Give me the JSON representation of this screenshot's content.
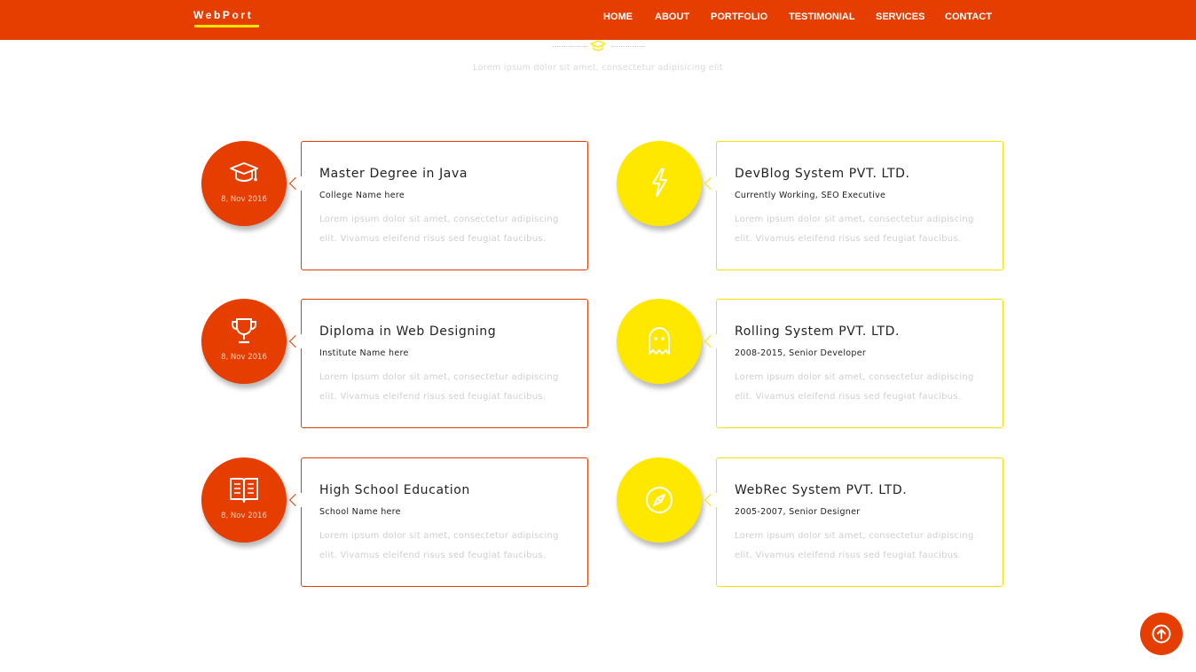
{
  "brand": {
    "name": "WebPort"
  },
  "nav": {
    "items": [
      {
        "label": "HOME"
      },
      {
        "label": "ABOUT"
      },
      {
        "label": "PORTFOLIO"
      },
      {
        "label": "TESTIMONIAL"
      },
      {
        "label": "SERVICES"
      },
      {
        "label": "CONTACT"
      }
    ]
  },
  "section": {
    "subtitle": "Lorem ipsum dolor sit amet, consectetur adipisicing elit",
    "icon": "graduation-cap-icon"
  },
  "education": [
    {
      "icon": "graduation-cap-icon",
      "date": "8, Nov 2016",
      "title": "Master Degree in Java",
      "subtitle": "College Name here",
      "description": "Lorem ipsum dolor sit amet, consectetur adipiscing elit. Vivamus eleifend risus sed feugiat faucibus."
    },
    {
      "icon": "trophy-icon",
      "date": "8, Nov 2016",
      "title": "Diploma in Web Designing",
      "subtitle": "Institute Name here",
      "description": "Lorem ipsum dolor sit amet, consectetur adipiscing elit. Vivamus eleifend risus sed feugiat faucibus."
    },
    {
      "icon": "book-icon",
      "date": "8, Nov 2016",
      "title": "High School Education",
      "subtitle": "School Name here",
      "description": "Lorem ipsum dolor sit amet, consectetur adipiscing elit. Vivamus eleifend risus sed feugiat faucibus."
    }
  ],
  "experience": [
    {
      "icon": "lightning-icon",
      "title": "DevBlog System PVT. LTD.",
      "subtitle": "Currently Working, SEO Executive",
      "description": "Lorem ipsum dolor sit amet, consectetur adipiscing elit. Vivamus eleifend risus sed feugiat faucibus."
    },
    {
      "icon": "ghost-icon",
      "title": "Rolling System PVT. LTD.",
      "subtitle": "2008-2015, Senior Developer",
      "description": "Lorem ipsum dolor sit amet, consectetur adipiscing elit. Vivamus eleifend risus sed feugiat faucibus."
    },
    {
      "icon": "compass-icon",
      "title": "WebRec System PVT. LTD.",
      "subtitle": "2005-2007, Senior Designer",
      "description": "Lorem ipsum dolor sit amet, consectetur adipiscing elit. Vivamus eleifend risus sed feugiat faucibus."
    }
  ],
  "colors": {
    "accent": "#e63d00",
    "secondary": "#ffe800"
  },
  "back_to_top": {
    "icon": "arrow-up-circle-icon"
  }
}
